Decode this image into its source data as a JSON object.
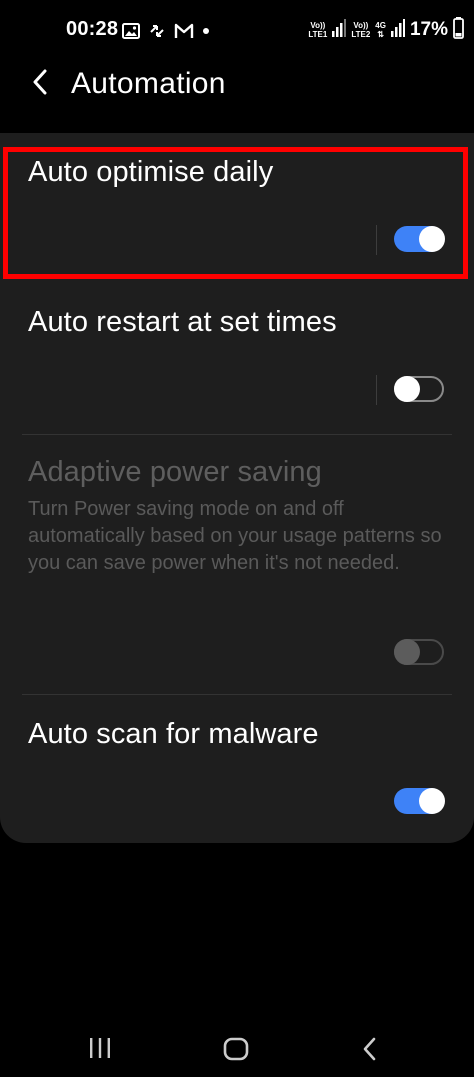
{
  "status_bar": {
    "time": "00:28",
    "sim1_top": "Vo))",
    "sim1_bottom": "LTE1",
    "sim2_top": "Vo))",
    "sim2_bottom": "LTE2",
    "network_type": "4G",
    "battery": "17%"
  },
  "header": {
    "title": "Automation",
    "back_icon": "chevron-left-icon"
  },
  "settings": [
    {
      "title": "Auto optimise daily",
      "enabled": true,
      "state": "on"
    },
    {
      "title": "Auto restart at set times",
      "enabled": true,
      "state": "off"
    },
    {
      "title": "Adaptive power saving",
      "description": "Turn Power saving mode on and off automatically based on your usage patterns so you can save power when it's not needed.",
      "enabled": false,
      "state": "off"
    },
    {
      "title": "Auto scan for malware",
      "enabled": true,
      "state": "on"
    }
  ],
  "colors": {
    "accent": "#3e82f7",
    "highlight": "#ff0000",
    "card_bg": "#1e1e1e"
  },
  "nav_bar": {
    "recents_icon": "recents-icon",
    "home_icon": "home-icon",
    "back_icon": "back-icon"
  }
}
